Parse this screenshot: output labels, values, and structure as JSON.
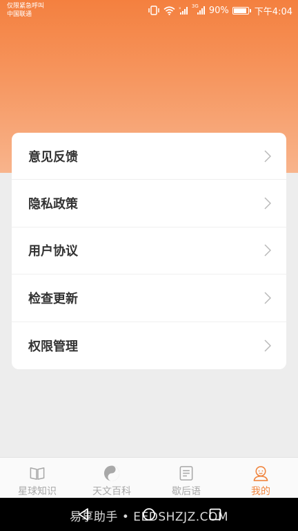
{
  "status": {
    "carrier_line1": "仅限紧急呼叫",
    "carrier_line2": "中国联通",
    "network": "3G",
    "battery": "90%",
    "time": "下午4:04"
  },
  "menu": {
    "items": [
      {
        "label": "意见反馈"
      },
      {
        "label": "隐私政策"
      },
      {
        "label": "用户协议"
      },
      {
        "label": "检查更新"
      },
      {
        "label": "权限管理"
      }
    ]
  },
  "tabs": [
    {
      "label": "星球知识",
      "icon": "book-icon",
      "active": false
    },
    {
      "label": "天文百科",
      "icon": "yin-yang-icon",
      "active": false
    },
    {
      "label": "歇后语",
      "icon": "document-icon",
      "active": false
    },
    {
      "label": "我的",
      "icon": "profile-icon",
      "active": true
    }
  ],
  "watermark": "易享助手 • EEDSHZJZ.COM",
  "colors": {
    "accent": "#f0853f",
    "header_top": "#f4803f",
    "header_bottom": "#f8b48c",
    "inactive_tab": "#a8a8a8"
  }
}
